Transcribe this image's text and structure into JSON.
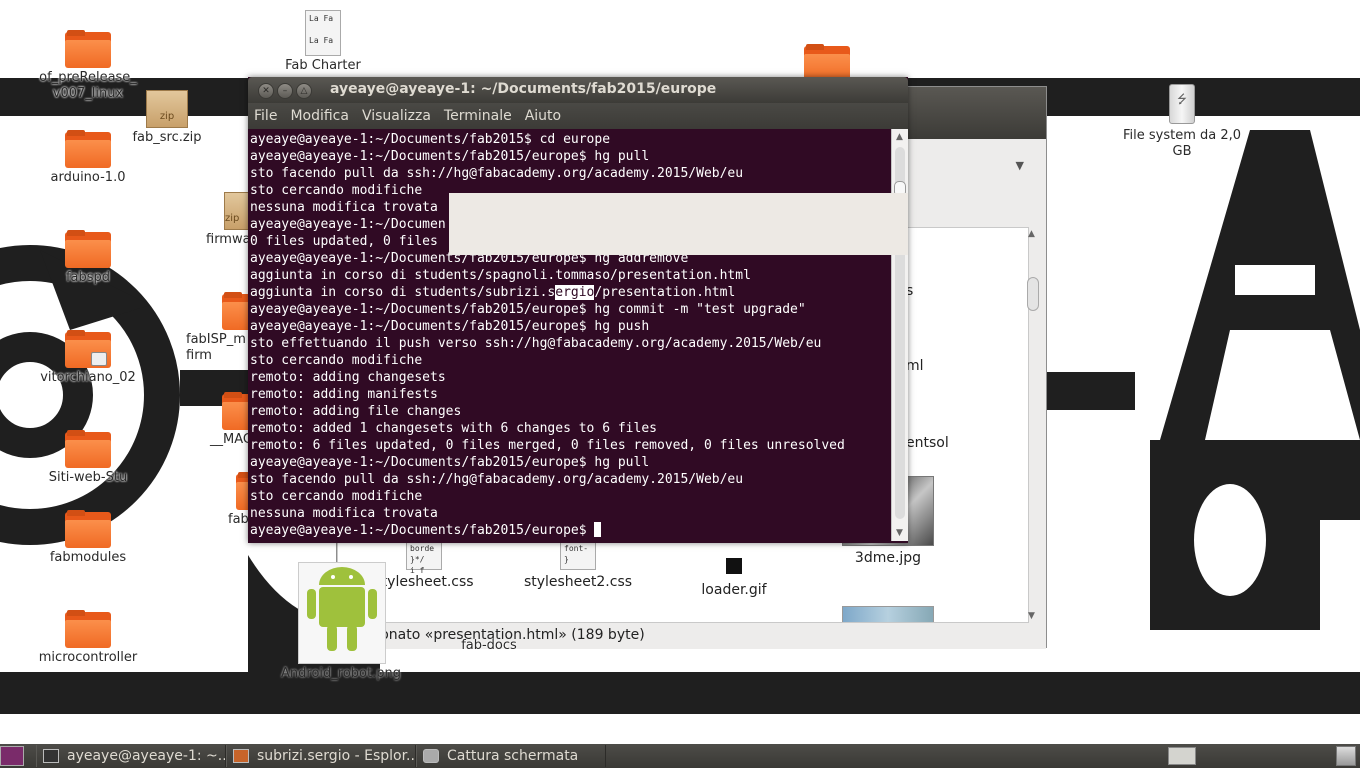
{
  "desktop": {
    "icons": [
      {
        "label": "of_preRelease_\nv007_linux",
        "type": "folder"
      },
      {
        "label": "fab_src.zip",
        "type": "zip"
      },
      {
        "label": "Fab Charter",
        "type": "document"
      },
      {
        "label": "arduino-1.0",
        "type": "folder"
      },
      {
        "label": "firmwa",
        "type": "zip"
      },
      {
        "label": "fabspd",
        "type": "folder"
      },
      {
        "label": "fabISP_m\nfirm",
        "type": "folder"
      },
      {
        "label": "vitorchiano_02",
        "type": "folder-locked"
      },
      {
        "label": "__MAC",
        "type": "folder"
      },
      {
        "label": "Siti-web-Stu",
        "type": "folder"
      },
      {
        "label": "fab",
        "type": "folder"
      },
      {
        "label": "fabmodules",
        "type": "folder"
      },
      {
        "label": "microcontroller",
        "type": "folder"
      },
      {
        "label": "File system da 2,0\nGB",
        "type": "usb-drive"
      },
      {
        "label": "Android_robot.png",
        "type": "image"
      },
      {
        "label": "fab-docs",
        "type": "folder"
      }
    ],
    "doc_preview": "La Fa\n\nLa Fa"
  },
  "terminal": {
    "title": "ayeaye@ayeaye-1: ~/Documents/fab2015/europe",
    "menu": [
      "File",
      "Modifica",
      "Visualizza",
      "Terminale",
      "Aiuto"
    ],
    "lines": [
      "ayeaye@ayeaye-1:~/Documents/fab2015$ cd europe",
      "ayeaye@ayeaye-1:~/Documents/fab2015/europe$ hg pull",
      "sto facendo pull da ssh://hg@fabacademy.org/academy.2015/Web/eu",
      "sto cercando modifiche",
      "nessuna modifica trovata",
      "ayeaye@ayeaye-1:~/Documen",
      "0 files updated, 0 files",
      "ayeaye@ayeaye-1:~/Documents/fab2015/europe$ hg addremove",
      "aggiunta in corso di students/spagnoli.tommaso/presentation.html",
      "ayeaye@ayeaye-1:~/Documents/fab2015/europe$ hg commit -m \"test upgrade\"",
      "ayeaye@ayeaye-1:~/Documents/fab2015/europe$ hg push",
      "sto effettuando il push verso ssh://hg@fabacademy.org/academy.2015/Web/eu",
      "sto cercando modifiche",
      "remoto: adding changesets",
      "remoto: adding manifests",
      "remoto: adding file changes",
      "remoto: added 1 changesets with 6 changes to 6 files",
      "remoto: 6 files updated, 0 files merged, 0 files removed, 0 files unresolved",
      "ayeaye@ayeaye-1:~/Documents/fab2015/europe$ hg pull",
      "sto facendo pull da ssh://hg@fabacademy.org/academy.2015/Web/eu",
      "sto cercando modifiche",
      "nessuna modifica trovata",
      "ayeaye@ayeaye-1:~/Documents/fab2015/europe$ "
    ],
    "selected_line": {
      "before": "aggiunta in corso di students/subrizi.s",
      "highlight": "ergio",
      "after": "/presentation.html"
    }
  },
  "file_manager": {
    "items": [
      {
        "name": "stylesheet.css",
        "preview": "borde\n}*/\ni f"
      },
      {
        "name": "stylesheet2.css",
        "preview": "font-\n}"
      },
      {
        "name": "loader.gif"
      },
      {
        "name": "3dme.jpg"
      }
    ],
    "partial_labels": [
      "s",
      "ml",
      "entsol"
    ],
    "status": "Selezionato «presentation.html» (189 byte)"
  },
  "taskbar": {
    "items": [
      {
        "label": "ayeaye@ayeaye-1: ~...",
        "icon": "terminal-icon"
      },
      {
        "label": "subrizi.sergio - Esplor...",
        "icon": "file-manager-icon"
      },
      {
        "label": "Cattura schermata",
        "icon": "camera-icon"
      }
    ]
  },
  "colors": {
    "terminal_bg": "#300a24",
    "titlebar": "#3c3b37",
    "folder_orange": "#f06a24"
  }
}
